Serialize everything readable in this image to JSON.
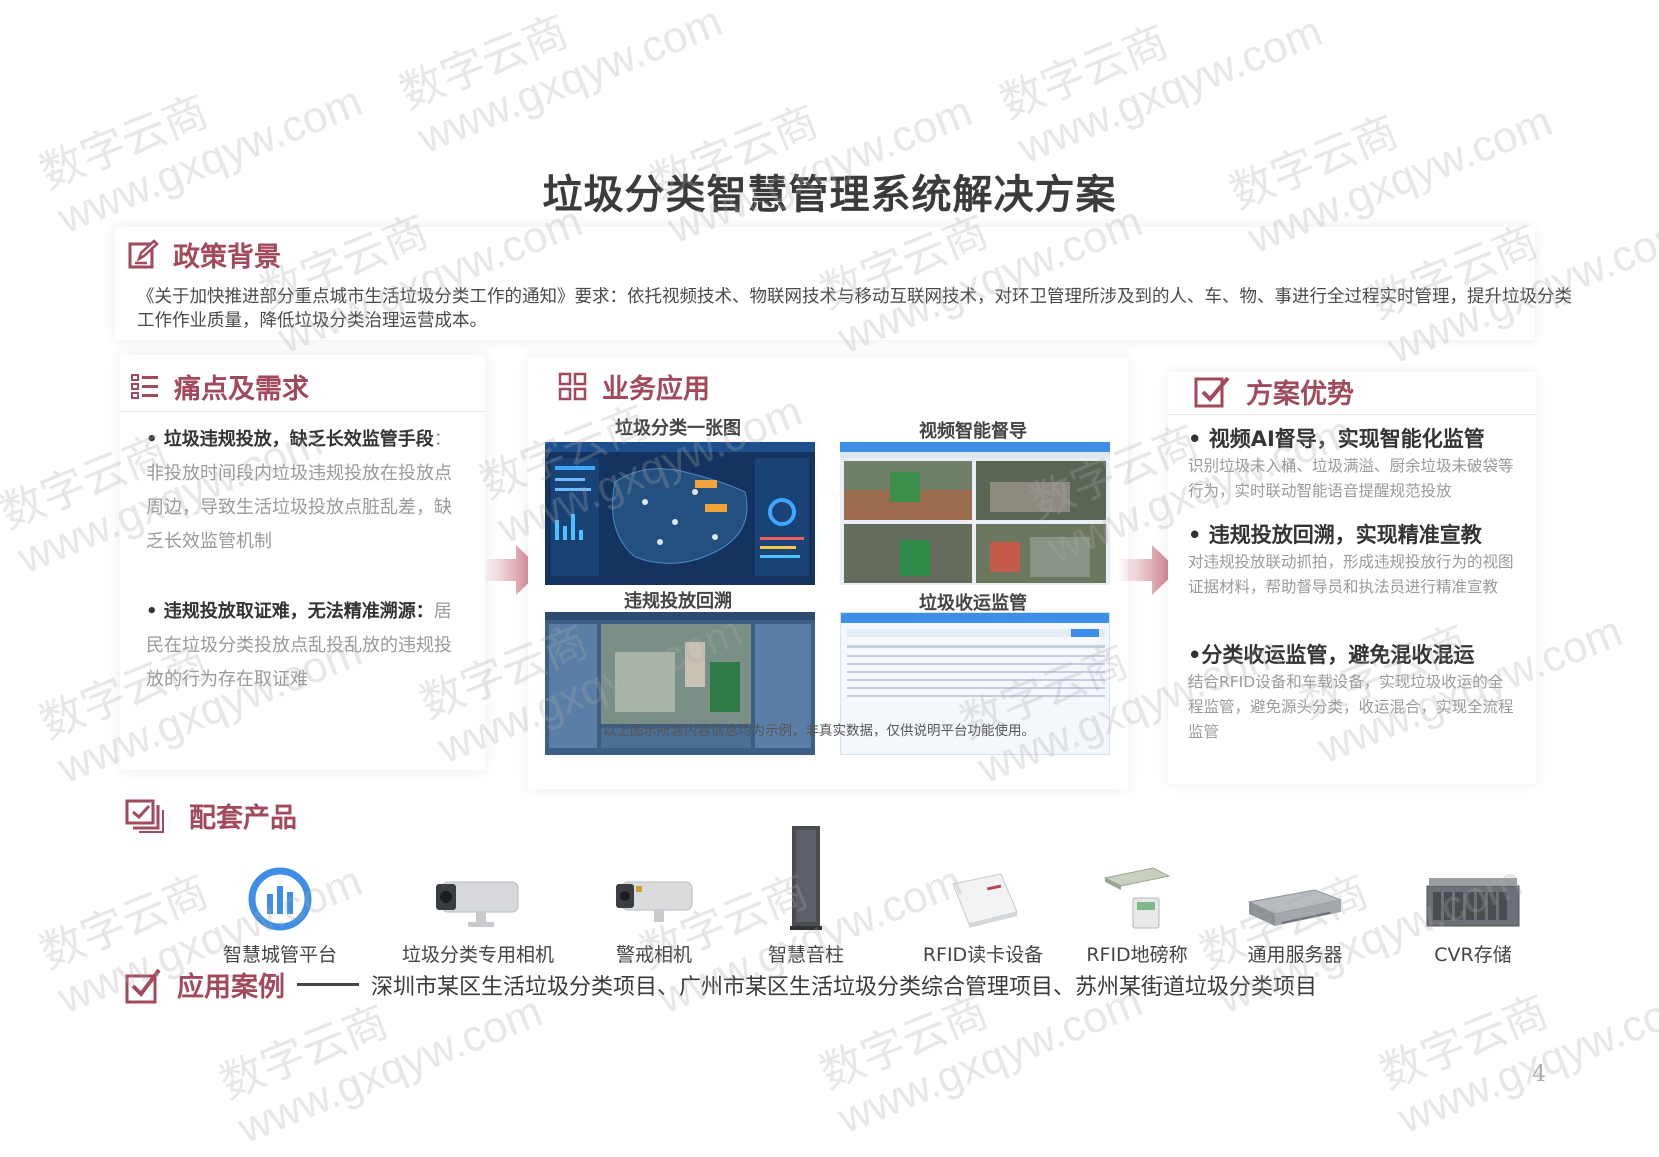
{
  "title": "垃圾分类智慧管理系统解决方案",
  "policy": {
    "heading": "政策背景",
    "text": "《关于加快推进部分重点城市生活垃圾分类工作的通知》要求：依托视频技术、物联网技术与移动互联网技术，对环卫管理所涉及到的人、车、物、事进行全过程实时管理，提升垃圾分类工作作业质量，降低垃圾分类治理运营成本。"
  },
  "pain": {
    "heading": "痛点及需求",
    "items": [
      {
        "bold": "垃圾违规投放，缺乏长效监管手段",
        "desc": "：非投放时间段内垃圾违规投放在投放点周边，导致生活垃圾投放点脏乱差，缺乏长效监管机制"
      },
      {
        "bold": "违规投放取证难，无法精准溯源：",
        "desc": "居民在垃圾分类投放点乱投乱放的违规投放的行为存在取证难"
      }
    ]
  },
  "apps": {
    "heading": "业务应用",
    "labels": [
      "垃圾分类一张图",
      "视频智能督导",
      "违规投放回溯",
      "垃圾收运监管"
    ],
    "note": "以上图示所含内容信息均为示例，非真实数据，仅供说明平台功能使用。"
  },
  "advantages": {
    "heading": "方案优势",
    "items": [
      {
        "title": "• 视频AI督导，实现智能化监管",
        "desc": "识别垃圾未入桶、垃圾满溢、厨余垃圾未破袋等行为，实时联动智能语音提醒规范投放"
      },
      {
        "title": "• 违规投放回溯，实现精准宣教",
        "desc": "对违规投放联动抓拍，形成违规投放行为的视图证据材料，帮助督导员和执法员进行精准宣教"
      },
      {
        "title": "•分类收运监管，避免混收混运",
        "desc": "结合RFID设备和车载设备，实现垃圾收运的全程监管，避免源头分类，收运混合，实现全流程监管"
      }
    ]
  },
  "products": {
    "heading": "配套产品",
    "items": [
      "智慧城管平台",
      "垃圾分类专用相机",
      "警戒相机",
      "智慧音柱",
      "RFID读卡设备",
      "RFID地磅称",
      "通用服务器",
      "CVR存储"
    ]
  },
  "cases": {
    "heading": "应用案例",
    "text": "深圳市某区生活垃圾分类项目、广州市某区生活垃圾分类综合管理项目、苏州某街道垃圾分类项目"
  },
  "page_number": "4",
  "watermark": {
    "brand": "数字云商",
    "url": "www.gxqyw.com"
  },
  "colors": {
    "accent": "#a24a5c",
    "arrow": "#c9707f",
    "blue": "#3d8ee6"
  }
}
